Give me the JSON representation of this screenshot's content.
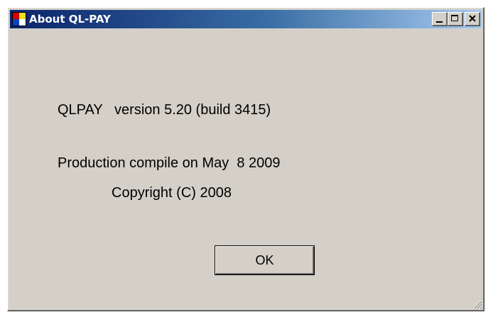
{
  "window": {
    "title": "About QL-PAY",
    "icon": "app-icon",
    "controls": [
      "minimize-icon",
      "maximize-icon",
      "close-icon"
    ]
  },
  "info": {
    "version_line": "QLPAY   version 5.20 (build 3415)",
    "compile_line": "Production compile on May  8 2009"
  },
  "copyright": "Copyright (C) 2008",
  "ok_label": "OK",
  "colors": {
    "face": "#d4d0c8",
    "title_start": "#0a246a",
    "title_end": "#a6caf0"
  }
}
